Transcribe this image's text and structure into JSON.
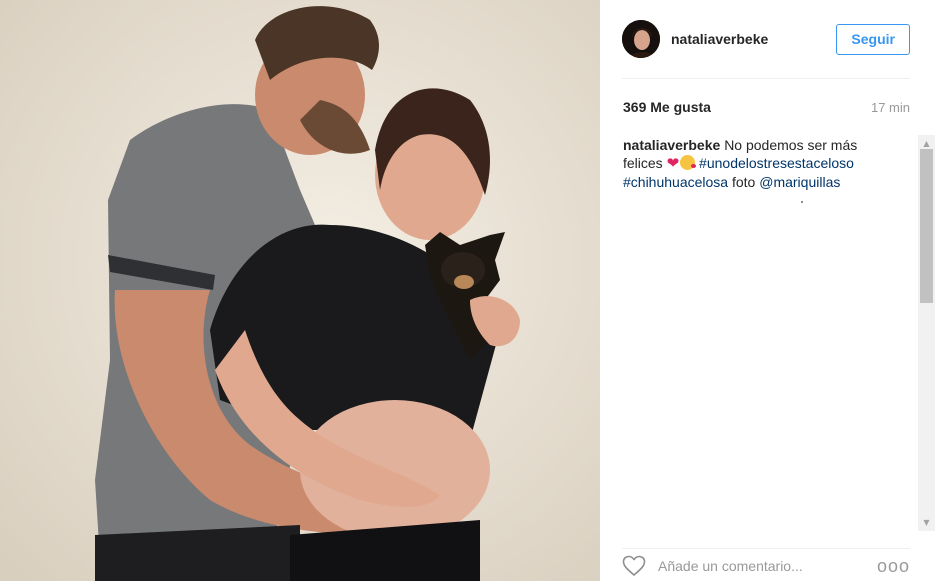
{
  "post": {
    "username": "nataliaverbeke",
    "follow_label": "Seguir",
    "likes": "369 Me gusta",
    "time": "17 min",
    "caption": {
      "author": "nataliaverbeke",
      "text_1": "No podemos ser más felices",
      "hashtag_1": "#unodelostresestaceloso",
      "hashtag_2": "#chihuhuacelosa",
      "text_2": "foto",
      "mention": "@mariquillas"
    },
    "comment": {
      "placeholder": "Añade un comentario..."
    },
    "more_label": "ooo"
  },
  "icons": {
    "like": "heart-outline-icon",
    "more": "more-options-icon",
    "scroll_up": "triangle-up",
    "scroll_down": "triangle-down"
  },
  "colors": {
    "follow_blue": "#3897f0",
    "link_blue": "#003569",
    "muted_gray": "#999999"
  }
}
